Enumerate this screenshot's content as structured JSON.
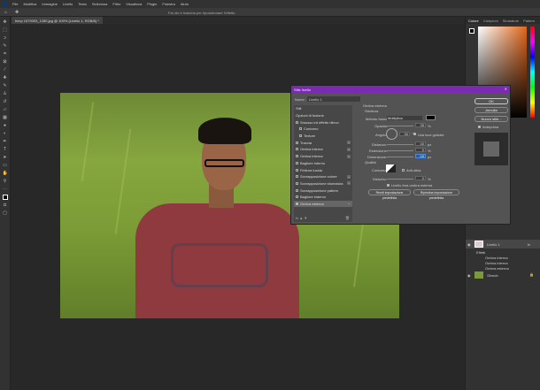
{
  "menu": [
    "File",
    "Modifica",
    "Immagine",
    "Livello",
    "Testo",
    "Seleziona",
    "Filtro",
    "Visualizza",
    "Plugin",
    "Finestra",
    "Aiuto"
  ],
  "options_hint": "Fai clic e trascina per riposizionare l'effetto.",
  "doc_tab": "bimp 1579393_1280.jpg @ 100% (Livello 1, RGB/8) *",
  "color_panel": {
    "tabs": [
      "Colore",
      "Campioni",
      "Sfumature",
      "Pattern"
    ],
    "hue_color": "#e0661a"
  },
  "layers": {
    "layer1": "Livello 1",
    "effects": "Effetti",
    "fx": [
      "Ombra interna",
      "Ombra interna",
      "Ombra esterna"
    ],
    "background": "Sfondo"
  },
  "dialog": {
    "title": "Stile livello",
    "name_label": "Nome:",
    "name_value": "Livello 1",
    "styles": [
      "Stili",
      "Opzioni di fusione",
      "Smusso ed effetto rilievo",
      "Contorno",
      "Texture",
      "Traccia",
      "Ombra interna",
      "Ombra interna",
      "Bagliore interno",
      "Finitura lucida",
      "Sovrapposizione colore",
      "Sovrapposizione sfumatura",
      "Sovrapposizione pattern",
      "Bagliore esterno",
      "Ombra esterna"
    ],
    "section": "Ombra esterna",
    "structure": "Struttura",
    "blend_label": "Metodo fusione:",
    "blend_value": "Moltiplica",
    "shadow_color": "#000000",
    "opacity_label": "Opacità:",
    "opacity": "35",
    "pct": "%",
    "angle_label": "Angolo:",
    "angle": "30",
    "deg": "°",
    "global_light": "Usa luce globale",
    "distance_label": "Distanza:",
    "distance": "40",
    "px": "px",
    "spread_label": "Estensione:",
    "spread": "0",
    "size_label": "Dimensione:",
    "size": "68",
    "quality": "Qualità",
    "contour_label": "Contorno:",
    "antialias": "Anti-alias",
    "noise_label": "Disturbo:",
    "noise": "0",
    "knockout": "Livello fora ombra esterna",
    "make_default": "Rendi impostazione predefinita",
    "reset_default": "Ripristina impostazione predefinita",
    "ok": "OK",
    "cancel": "Annulla",
    "new_style": "Nuovo stile...",
    "preview": "Anteprima"
  }
}
